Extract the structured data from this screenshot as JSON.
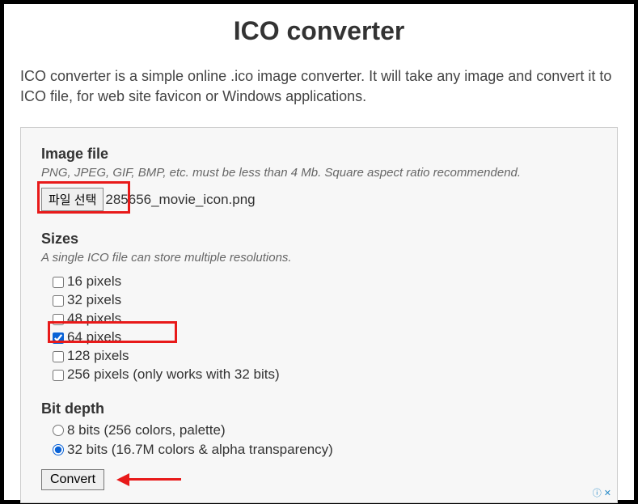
{
  "title": "ICO converter",
  "description": "ICO converter is a simple online .ico image converter. It will take any image and convert it to ICO file, for web site favicon or Windows applications.",
  "imageFile": {
    "heading": "Image file",
    "hint": "PNG, JPEG, GIF, BMP, etc. must be less than 4 Mb. Square aspect ratio recommendend.",
    "buttonLabel": "파일 선택",
    "selectedFile": "285656_movie_icon.png"
  },
  "sizes": {
    "heading": "Sizes",
    "hint": "A single ICO file can store multiple resolutions.",
    "options": [
      {
        "label": "16 pixels",
        "checked": false
      },
      {
        "label": "32 pixels",
        "checked": false
      },
      {
        "label": "48 pixels",
        "checked": false
      },
      {
        "label": "64 pixels",
        "checked": true
      },
      {
        "label": "128 pixels",
        "checked": false
      },
      {
        "label": "256 pixels (only works with 32 bits)",
        "checked": false
      }
    ]
  },
  "bitDepth": {
    "heading": "Bit depth",
    "options": [
      {
        "label": "8 bits (256 colors, palette)",
        "checked": false
      },
      {
        "label": "32 bits (16.7M colors & alpha transparency)",
        "checked": true
      }
    ]
  },
  "convertLabel": "Convert",
  "adMarker": "ⓘ ✕"
}
